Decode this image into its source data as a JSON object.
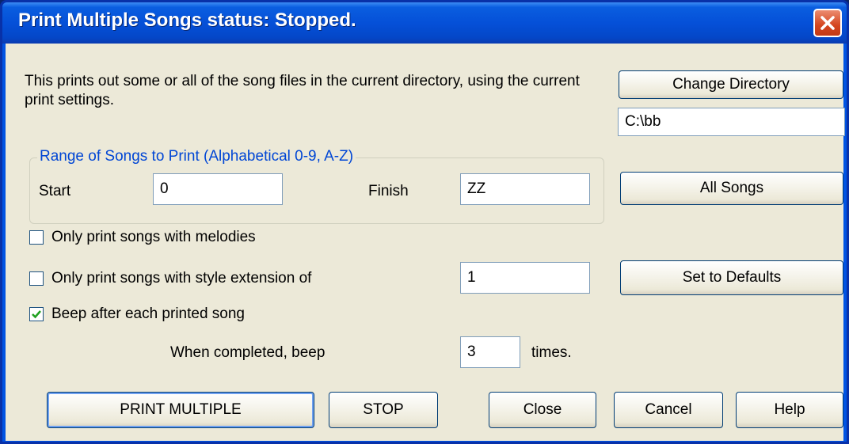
{
  "window": {
    "title": "Print Multiple Songs status: Stopped."
  },
  "description": "This prints out some or all of the song files in the current directory, using the current print settings.",
  "directory": {
    "button_label": "Change Directory",
    "value": "C:\\bb"
  },
  "range": {
    "group_label": "Range of Songs to Print  (Alphabetical 0-9, A-Z)",
    "start_label": "Start",
    "start_value": "0",
    "finish_label": "Finish",
    "finish_value": "ZZ",
    "all_songs_label": "All Songs"
  },
  "options": {
    "melodies_label": "Only print songs with melodies",
    "melodies_checked": false,
    "style_ext_label": "Only print songs with style extension of",
    "style_ext_checked": false,
    "style_ext_value": "1",
    "defaults_label": "Set to Defaults",
    "beep_label": "Beep after each printed song",
    "beep_checked": true,
    "completed_label": "When completed, beep",
    "beep_count": "3",
    "times_label": "times."
  },
  "buttons": {
    "print_multiple": "PRINT MULTIPLE",
    "stop": "STOP",
    "close": "Close",
    "cancel": "Cancel",
    "help": "Help"
  },
  "colors": {
    "titlebar": "#0054e3",
    "dialog_bg": "#ece9d8",
    "group_label": "#0046d5",
    "close_button": "#d4451f"
  }
}
